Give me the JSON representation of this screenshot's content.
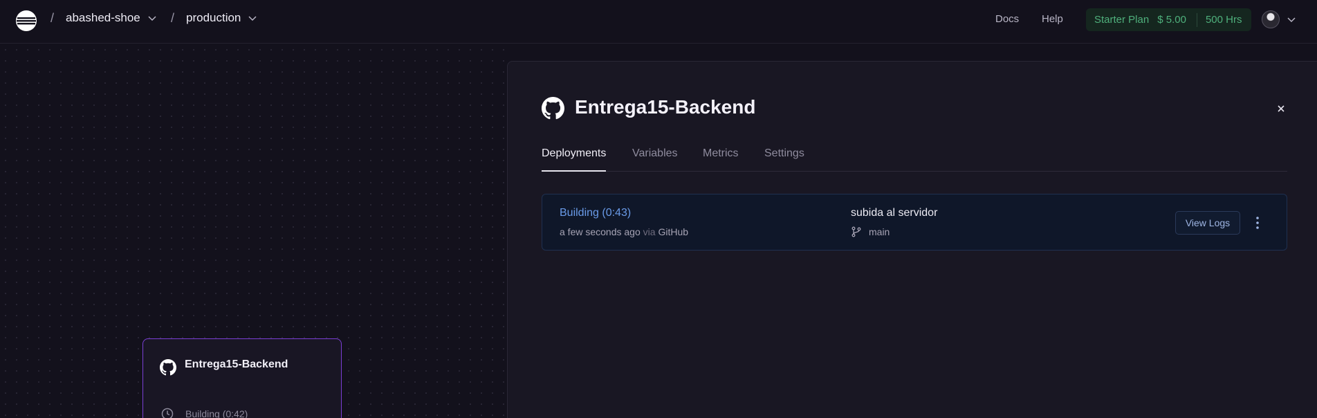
{
  "topbar": {
    "project": "abashed-shoe",
    "environment": "production",
    "separator": "/",
    "docs": "Docs",
    "help": "Help",
    "plan": {
      "name": "Starter Plan",
      "price": "$ 5.00",
      "hours": "500 Hrs"
    }
  },
  "canvas": {
    "service_card": {
      "name": "Entrega15-Backend",
      "status": "Building (0:42)"
    }
  },
  "panel": {
    "title": "Entrega15-Backend",
    "tabs": [
      "Deployments",
      "Variables",
      "Metrics",
      "Settings"
    ],
    "deployment": {
      "status": "Building (0:43)",
      "time": "a few seconds ago",
      "via": "via",
      "source": "GitHub",
      "commit_message": "subida al servidor",
      "branch": "main",
      "view_logs_label": "View Logs"
    }
  },
  "colors": {
    "accent_purple": "#7b3fd6",
    "status_blue": "#6a9be8",
    "plan_green": "#4fb07c"
  },
  "icons": [
    "railway-logo-icon",
    "chevron-down-icon",
    "github-icon",
    "clock-icon",
    "close-icon",
    "git-branch-icon",
    "more-vertical-icon"
  ]
}
